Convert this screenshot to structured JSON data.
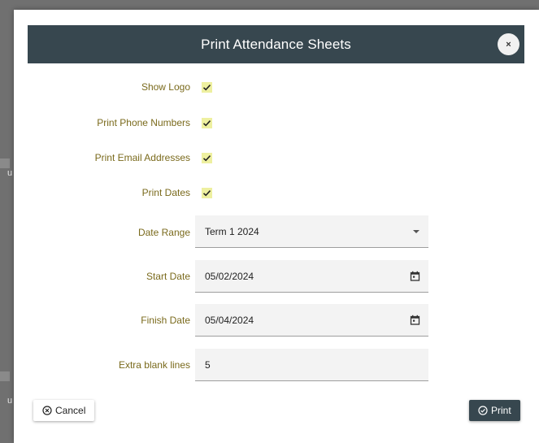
{
  "dialog": {
    "title": "Print Attendance Sheets",
    "close_label": "×"
  },
  "background": {
    "edge_letter_1": "u",
    "edge_letter_2": "u"
  },
  "options": {
    "show_logo": {
      "label": "Show Logo",
      "checked": true
    },
    "print_phone_numbers": {
      "label": "Print Phone Numbers",
      "checked": true
    },
    "print_email_addresses": {
      "label": "Print Email Addresses",
      "checked": true
    },
    "print_dates": {
      "label": "Print Dates",
      "checked": true
    }
  },
  "fields": {
    "date_range": {
      "label": "Date Range",
      "value": "Term 1 2024"
    },
    "start_date": {
      "label": "Start Date",
      "value": "05/02/2024"
    },
    "finish_date": {
      "label": "Finish Date",
      "value": "05/04/2024"
    },
    "extra_blank_lines": {
      "label": "Extra blank lines",
      "value": "5"
    }
  },
  "buttons": {
    "cancel_label": "Cancel",
    "print_label": "Print"
  },
  "colors": {
    "header_bg": "#37474f",
    "label_text": "#7a6a1c",
    "checkbox_bg": "#eef0a0",
    "field_bg": "#f3f3f3"
  },
  "icons": {
    "close": "close-icon",
    "checkmark": "checkmark-icon",
    "dropdown": "chevron-down-icon",
    "calendar": "calendar-icon",
    "cancel": "cancel-circle-icon",
    "print": "check-circle-icon"
  }
}
